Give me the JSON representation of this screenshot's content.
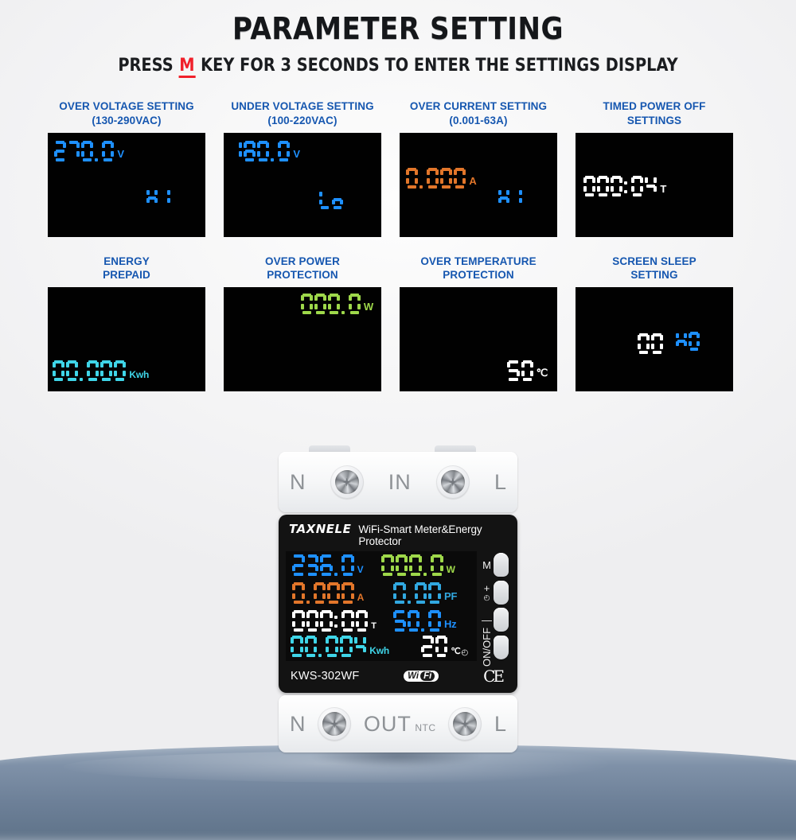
{
  "header": {
    "title": "PARAMETER SETTING",
    "subtitle_before": "PRESS ",
    "subtitle_key": "M",
    "subtitle_after": " KEY FOR 3 SECONDS TO ENTER THE SETTINGS DISPLAY",
    "key_color": "#f0202a"
  },
  "colors": {
    "label_blue": "#1657b0",
    "seg_blue": "#1e90ff",
    "seg_orange": "#e2762a",
    "seg_white": "#ffffff",
    "seg_green": "#9ed84a",
    "seg_cyan": "#3fd5e8",
    "panel_black": "#010101"
  },
  "panels": [
    {
      "label_line1": "OVER VOLTAGE SETTING",
      "label_line2": "(130-290VAC)",
      "primary_value": "270.0",
      "primary_unit": "V",
      "primary_color": "#1e90ff",
      "primary_pos": "top-left",
      "secondary_value": "H1",
      "secondary_color": "#1e90ff"
    },
    {
      "label_line1": "UNDER VOLTAGE SETTING",
      "label_line2": "(100-220VAC)",
      "primary_value": "180.0",
      "primary_unit": "V",
      "primary_color": "#1e90ff",
      "primary_pos": "top-left",
      "secondary_value": "Lo",
      "secondary_color": "#1e90ff"
    },
    {
      "label_line1": "OVER CURRENT SETTING",
      "label_line2": "(0.001-63A)",
      "primary_value": "0.000",
      "primary_unit": "A",
      "primary_color": "#e2762a",
      "primary_pos": "mid-left",
      "secondary_value": "H1",
      "secondary_color": "#1e90ff"
    },
    {
      "label_line1": "TIMED POWER OFF",
      "label_line2": "SETTINGS",
      "primary_value": "000:04",
      "primary_unit": "T",
      "primary_color": "#ffffff",
      "primary_pos": "center-left",
      "secondary_value": "",
      "secondary_color": "#ffffff"
    },
    {
      "label_line1": "ENERGY",
      "label_line2": "PREPAID",
      "primary_value": "00.000",
      "primary_unit": "Kwh",
      "primary_color": "#3fd5e8",
      "primary_pos": "bottom-left",
      "secondary_value": "",
      "secondary_color": "#3fd5e8"
    },
    {
      "label_line1": "OVER POWER",
      "label_line2": "PROTECTION",
      "primary_value": "000.0",
      "primary_unit": "W",
      "primary_color": "#9ed84a",
      "primary_pos": "top-right",
      "secondary_value": "",
      "secondary_color": "#9ed84a"
    },
    {
      "label_line1": "OVER TEMPERATURE",
      "label_line2": "PROTECTION",
      "primary_value": "50",
      "primary_unit": "℃",
      "primary_color": "#ffffff",
      "primary_pos": "bottom-right",
      "secondary_value": "",
      "secondary_color": "#ffffff"
    },
    {
      "label_line1": "SCREEN SLEEP",
      "label_line2": "SETTING",
      "primary_value": "00",
      "primary_unit": "",
      "primary_color": "#ffffff",
      "primary_pos": "center-mid",
      "secondary_value": "H0",
      "secondary_color": "#1e90ff"
    }
  ],
  "device": {
    "terminal_top": {
      "left": "N",
      "middle": "IN",
      "right": "L"
    },
    "terminal_bottom": {
      "left": "N",
      "middle": "OUT",
      "middle_sub": "NTC",
      "right": "L"
    },
    "brand": "TAXNELE",
    "tagline": "WiFi-Smart Meter&Energy Protector",
    "model": "KWS-302WF",
    "wifi_badge_left": "Wi",
    "wifi_badge_right": "Fi",
    "ce_mark": "CE",
    "buttons": [
      {
        "label": "M",
        "wifi": false
      },
      {
        "label": "+",
        "wifi": true
      },
      {
        "label": "—",
        "wifi": false
      },
      {
        "label": "ON/OFF",
        "wifi": false,
        "rotated": true
      }
    ],
    "lcd": {
      "voltage": {
        "value": "236.0",
        "unit": "V",
        "color": "#1e90ff"
      },
      "power": {
        "value": "000.0",
        "unit": "W",
        "color": "#9ed84a"
      },
      "current": {
        "value": "0.000",
        "unit": "A",
        "color": "#e2762a"
      },
      "power_factor": {
        "value": "0.00",
        "unit": "PF",
        "color": "#31a8e0"
      },
      "timer": {
        "value": "000:00",
        "unit": "T",
        "color": "#ffffff"
      },
      "frequency": {
        "value": "50.0",
        "unit": "Hz",
        "color": "#1e90ff"
      },
      "energy": {
        "value": "00.004",
        "unit": "Kwh",
        "color": "#3fd5e8"
      },
      "temperature": {
        "value": "20",
        "unit": "℃",
        "color": "#ffffff",
        "wifi_icon": true
      }
    }
  }
}
